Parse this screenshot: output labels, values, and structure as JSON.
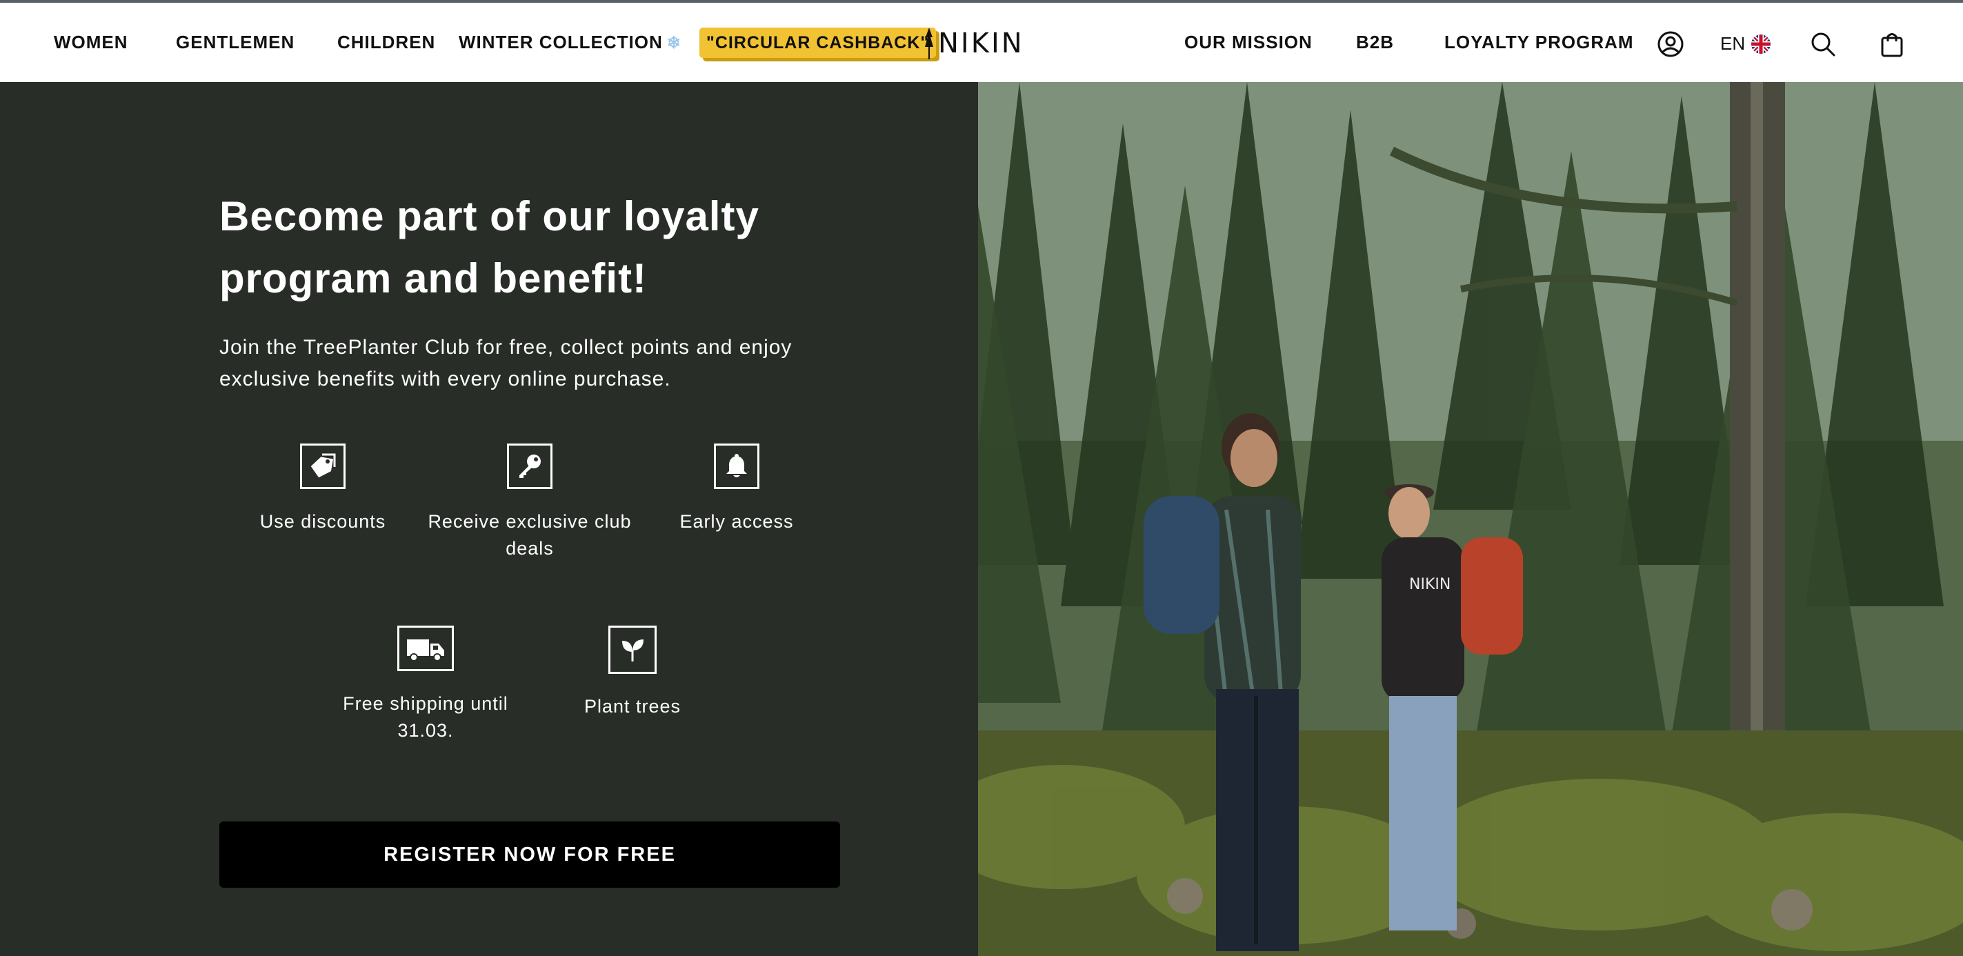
{
  "header": {
    "nav_left": [
      "WOMEN",
      "GENTLEMEN",
      "CHILDREN",
      "WINTER COLLECTION"
    ],
    "winter_icon": "snowflake-icon",
    "promo": "\"CIRCULAR CASHBACK\"",
    "brand": "NIKIN",
    "nav_right": [
      "OUR MISSION",
      "B2B",
      "LOYALTY PROGRAM"
    ],
    "language": "EN",
    "icons": [
      "account-icon",
      "uk-flag-icon",
      "search-icon",
      "cart-icon"
    ]
  },
  "hero": {
    "title": "Become part of our loyalty program and benefit!",
    "intro": "Join the TreePlanter Club for free, collect points and enjoy exclusive benefits with every online purchase.",
    "benefits": [
      {
        "label": "Use discounts",
        "icon": "tag-icon"
      },
      {
        "label": "Receive exclusive club deals",
        "icon": "key-icon"
      },
      {
        "label": "Early access",
        "icon": "bell-icon"
      },
      {
        "label": "Free shipping until 31.03.",
        "icon": "truck-icon"
      },
      {
        "label": "Plant trees",
        "icon": "sprout-icon"
      }
    ],
    "cta": "REGISTER NOW FOR FREE"
  },
  "image": {
    "description_icon": "hikers-forest-photo",
    "hoodie_print": "NIKIN"
  },
  "colors": {
    "panel_bg": "#282d28",
    "promo_yellow": "#f1c232",
    "cta_bg": "#000000"
  }
}
